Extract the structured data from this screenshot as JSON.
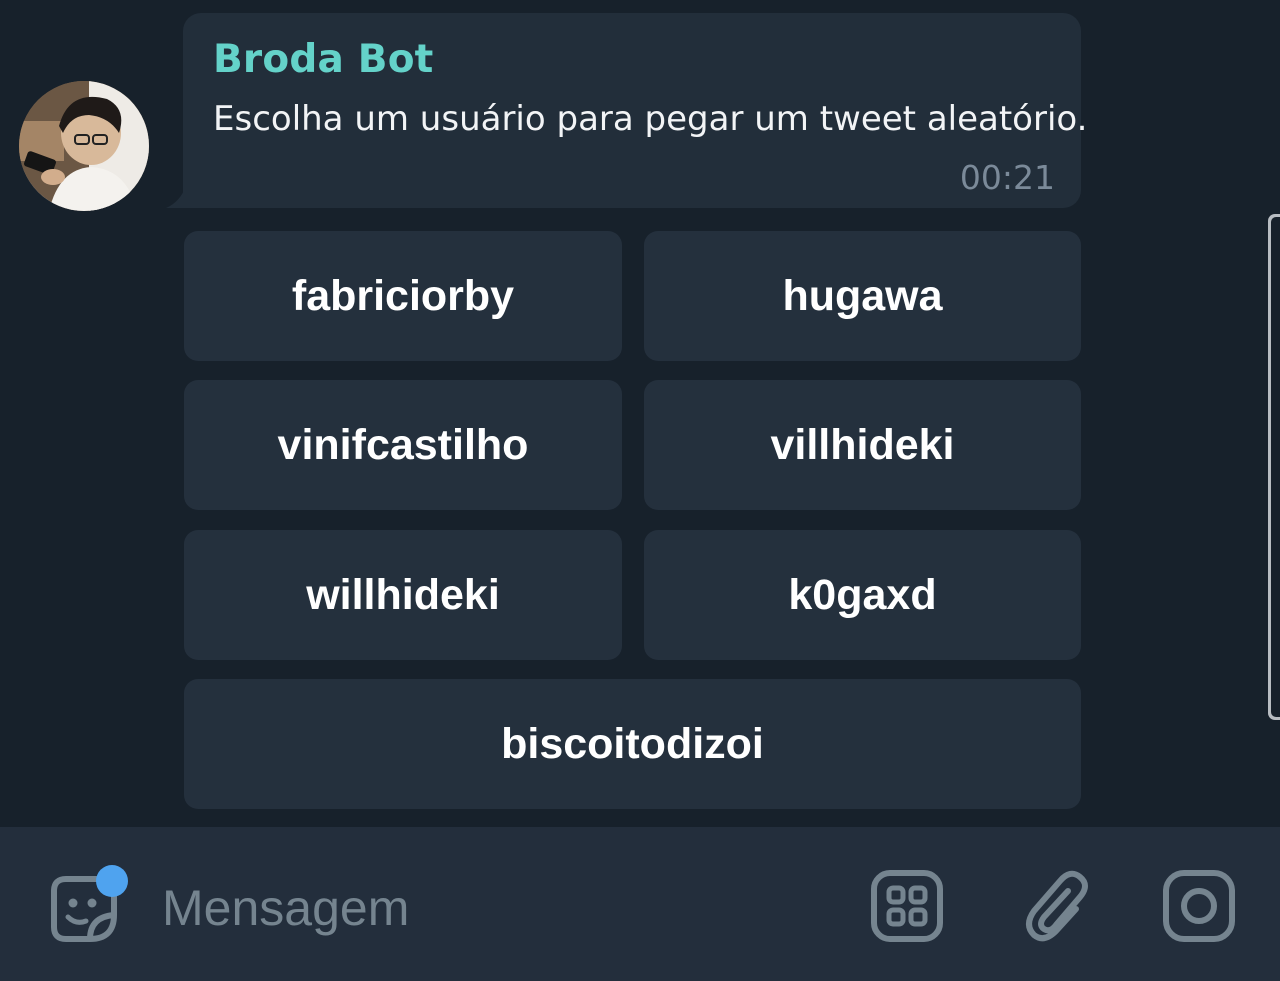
{
  "message": {
    "sender": "Broda Bot",
    "text": "Escolha um usuário para pegar um tweet aleatório.",
    "time": "00:21"
  },
  "keyboard": {
    "buttons": [
      "fabriciorby",
      "hugawa",
      "vinifcastilho",
      "villhideki",
      "willhideki",
      "k0gaxd",
      "biscoitodizoi"
    ]
  },
  "composer": {
    "placeholder": "Mensagem",
    "icons": [
      "sticker-icon",
      "bot-commands-icon",
      "attach-icon",
      "camera-icon"
    ]
  },
  "colors": {
    "background": "#17212b",
    "bubble": "#222e3a",
    "button": "#24303d",
    "sender": "#64d2c9",
    "accent_dot": "#4fa3ef"
  }
}
